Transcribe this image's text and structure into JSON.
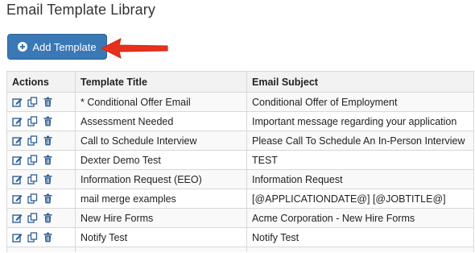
{
  "page": {
    "title": "Email Template Library"
  },
  "toolbar": {
    "add_label": "Add Template"
  },
  "colors": {
    "button": "#3a78b6",
    "arrow": "#e8311c",
    "icon": "#2f5f93"
  },
  "table": {
    "headers": {
      "actions": "Actions",
      "title": "Template Title",
      "subject": "Email Subject"
    },
    "action_icons": [
      "edit-icon",
      "copy-icon",
      "trash-icon"
    ],
    "rows": [
      {
        "title": "* Conditional Offer Email",
        "subject": "Conditional Offer of Employment"
      },
      {
        "title": "Assessment Needed",
        "subject": "Important message regarding your application"
      },
      {
        "title": "Call to Schedule Interview",
        "subject": "Please Call To Schedule An In-Person Interview"
      },
      {
        "title": "Dexter Demo Test",
        "subject": "TEST"
      },
      {
        "title": "Information Request (EEO)",
        "subject": "Information Request"
      },
      {
        "title": "mail merge examples",
        "subject": "[@APPLICATIONDATE@] [@JOBTITLE@]"
      },
      {
        "title": "New Hire Forms",
        "subject": "Acme Corporation - New Hire Forms"
      },
      {
        "title": "Notify Test",
        "subject": "Notify Test"
      }
    ]
  }
}
